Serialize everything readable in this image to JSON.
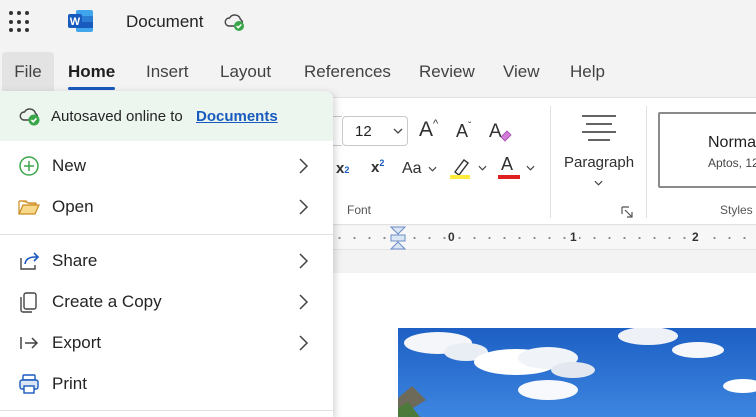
{
  "titlebar": {
    "app_icon": "word-icon",
    "document_title": "Document",
    "save_status_icon": "cloud-saved-icon"
  },
  "tabs": [
    {
      "label": "File",
      "selected": false,
      "open": true
    },
    {
      "label": "Home",
      "selected": true
    },
    {
      "label": "Insert"
    },
    {
      "label": "Layout"
    },
    {
      "label": "References"
    },
    {
      "label": "Review"
    },
    {
      "label": "View"
    },
    {
      "label": "Help"
    }
  ],
  "ribbon": {
    "font_size": "12",
    "font_group_label": "Font",
    "paragraph_label": "Paragraph",
    "styles_label": "Styles",
    "style_preview_name": "Normal",
    "style_preview_font": "Aptos, 12",
    "grow_font_label": "A",
    "shrink_font_label": "A",
    "change_case_label": "Aa",
    "font_color_label": "A",
    "highlight_color": "#ffeb3b",
    "font_color": "#e02020"
  },
  "ruler": {
    "marks": [
      "0",
      "1",
      "2"
    ]
  },
  "file_menu": {
    "autosave_text": "Autosaved online to",
    "autosave_link": "Documents",
    "items": [
      {
        "label": "New",
        "icon": "plus-circle-icon",
        "has_submenu": true
      },
      {
        "label": "Open",
        "icon": "folder-open-icon",
        "has_submenu": true
      },
      {
        "label": "Share",
        "icon": "share-icon",
        "has_submenu": true
      },
      {
        "label": "Create a Copy",
        "icon": "copy-icon",
        "has_submenu": true
      },
      {
        "label": "Export",
        "icon": "export-icon",
        "has_submenu": true
      },
      {
        "label": "Print",
        "icon": "print-icon",
        "has_submenu": false
      }
    ]
  },
  "colors": {
    "accent": "#185abd",
    "autosave_bg": "#edf6ee",
    "success_green": "#3aa64a"
  }
}
